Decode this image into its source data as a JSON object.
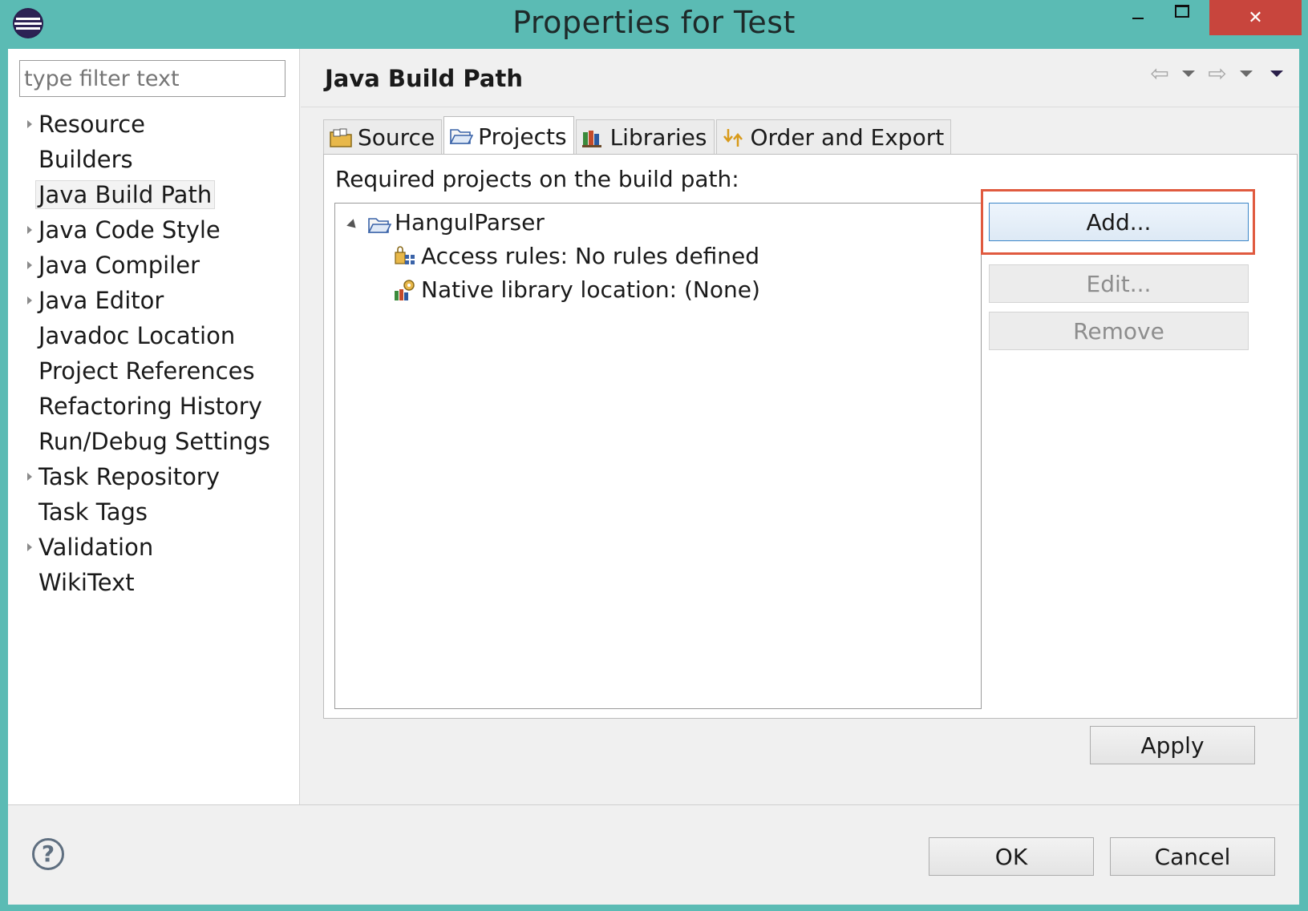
{
  "window": {
    "title": "Properties for Test",
    "close_glyph": "✕"
  },
  "filter": {
    "placeholder": "type filter text"
  },
  "tree": {
    "items": [
      {
        "label": "Resource",
        "expandable": true
      },
      {
        "label": "Builders",
        "expandable": false
      },
      {
        "label": "Java Build Path",
        "expandable": false,
        "selected": true
      },
      {
        "label": "Java Code Style",
        "expandable": true
      },
      {
        "label": "Java Compiler",
        "expandable": true
      },
      {
        "label": "Java Editor",
        "expandable": true
      },
      {
        "label": "Javadoc Location",
        "expandable": false
      },
      {
        "label": "Project References",
        "expandable": false
      },
      {
        "label": "Refactoring History",
        "expandable": false
      },
      {
        "label": "Run/Debug Settings",
        "expandable": false
      },
      {
        "label": "Task Repository",
        "expandable": true
      },
      {
        "label": "Task Tags",
        "expandable": false
      },
      {
        "label": "Validation",
        "expandable": true
      },
      {
        "label": "WikiText",
        "expandable": false
      }
    ]
  },
  "page": {
    "title": "Java Build Path",
    "nav_back_glyph": "⇦",
    "nav_forward_glyph": "⇨"
  },
  "tabs": [
    {
      "label": "Source",
      "icon": "source-folder-icon"
    },
    {
      "label": "Projects",
      "icon": "projects-folder-icon",
      "active": true
    },
    {
      "label": "Libraries",
      "icon": "libraries-icon"
    },
    {
      "label": "Order and Export",
      "icon": "order-export-icon"
    }
  ],
  "projects_tab": {
    "label": "Required projects on the build path:",
    "project": {
      "name": "HangulParser",
      "children": [
        "Access rules: No rules defined",
        "Native library location: (None)"
      ]
    },
    "buttons": {
      "add": "Add...",
      "edit": "Edit...",
      "remove": "Remove"
    }
  },
  "apply_label": "Apply",
  "footer": {
    "help_glyph": "?",
    "ok_label": "OK",
    "cancel_label": "Cancel"
  },
  "colors": {
    "frame": "#5bbbb4",
    "close_button": "#c8453d",
    "highlight": "#e05a3f",
    "default_button_border": "#3c86c8"
  }
}
